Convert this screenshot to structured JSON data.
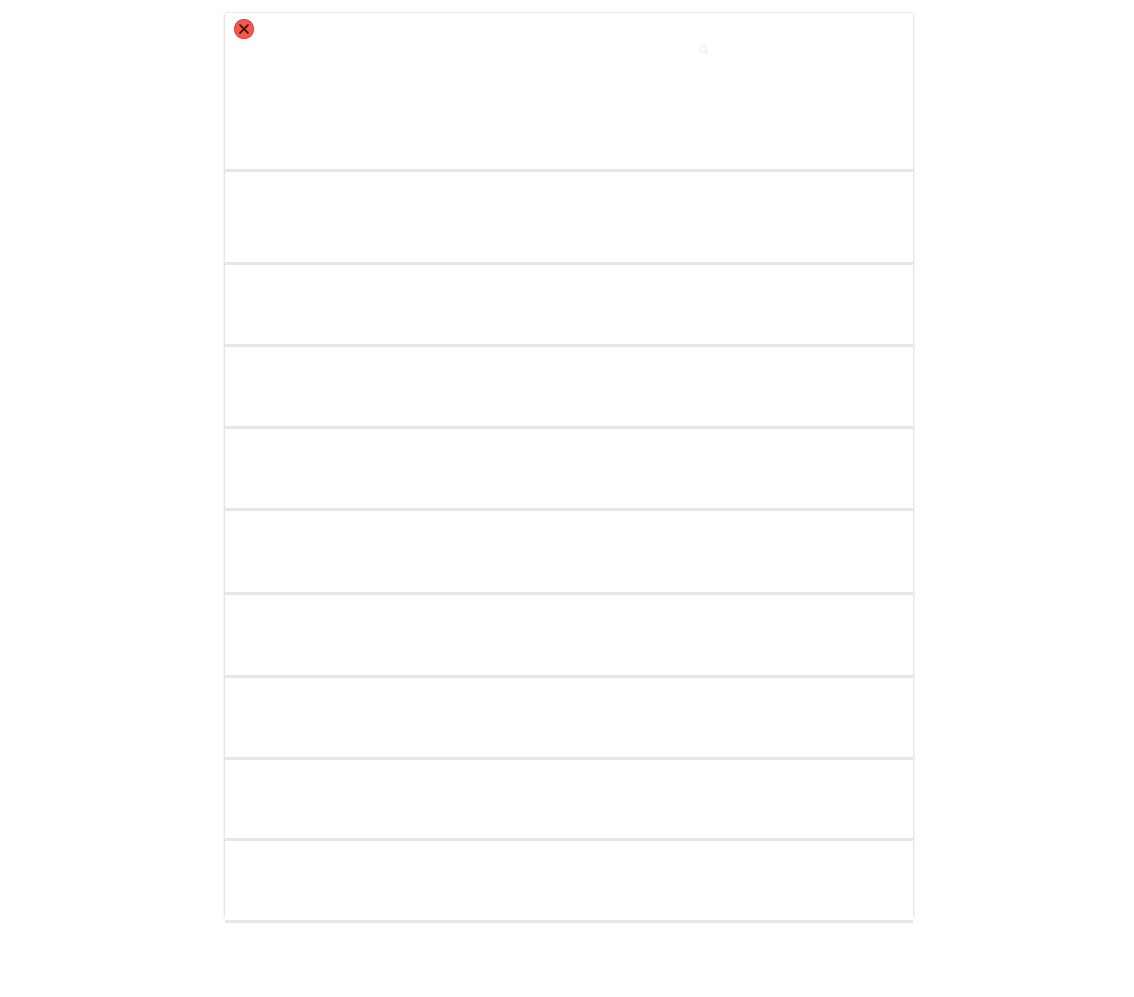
{
  "window": {
    "close_icon": "close-icon",
    "search_icon": "search-icon"
  },
  "colors": {
    "close_button": "#f5574e",
    "divider": "#e6e6e6",
    "background": "#ffffff"
  },
  "list": {
    "items": [
      {
        "label": ""
      },
      {
        "label": ""
      },
      {
        "label": ""
      },
      {
        "label": ""
      },
      {
        "label": ""
      },
      {
        "label": ""
      },
      {
        "label": ""
      },
      {
        "label": ""
      },
      {
        "label": ""
      },
      {
        "label": ""
      }
    ]
  }
}
